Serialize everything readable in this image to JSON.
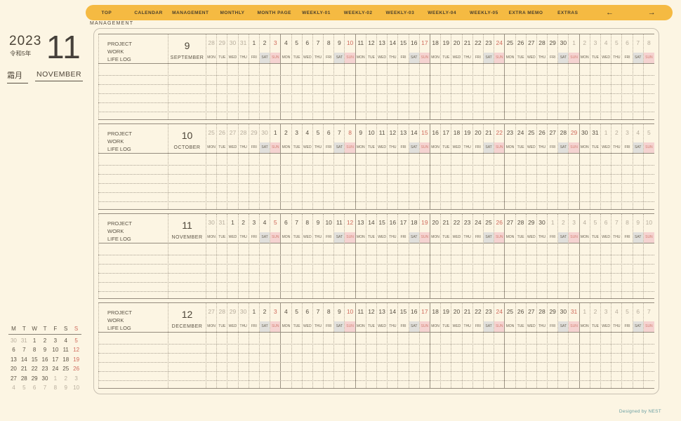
{
  "nav": {
    "items": [
      "TOP",
      "CALENDAR",
      "MANAGEMENT",
      "MONTHLY",
      "MONTH PAGE",
      "WEEKLY-01",
      "WEEKLY-02",
      "WEEKLY-03",
      "WEEKLY-04",
      "WEEKLY-05",
      "EXTRA MEMO",
      "EXTRAS"
    ],
    "arrow_left": "←",
    "arrow_right": "→"
  },
  "page_label": "MANAGEMENT",
  "sidebar": {
    "year": "2023",
    "era": "令和5年",
    "month_number": "11",
    "month_jp": "霜月",
    "month_en": "NOVEMBER"
  },
  "row_labels": [
    "PROJECT",
    "WORK",
    "LIFE LOG"
  ],
  "dow": [
    "MON",
    "TUE",
    "WED",
    "THU",
    "FRI",
    "SAT",
    "SUN"
  ],
  "months": [
    {
      "num": "9",
      "name": "SEPTEMBER",
      "days": [
        [
          "28",
          "o"
        ],
        [
          "29",
          "o"
        ],
        [
          "30",
          "o"
        ],
        [
          "31",
          "o"
        ],
        [
          "1",
          ""
        ],
        [
          "2",
          ""
        ],
        [
          "3",
          "s"
        ],
        [
          "4",
          ""
        ],
        [
          "5",
          ""
        ],
        [
          "6",
          ""
        ],
        [
          "7",
          ""
        ],
        [
          "8",
          ""
        ],
        [
          "9",
          ""
        ],
        [
          "10",
          "s"
        ],
        [
          "11",
          ""
        ],
        [
          "12",
          ""
        ],
        [
          "13",
          ""
        ],
        [
          "14",
          ""
        ],
        [
          "15",
          ""
        ],
        [
          "16",
          ""
        ],
        [
          "17",
          "s"
        ],
        [
          "18",
          ""
        ],
        [
          "19",
          ""
        ],
        [
          "20",
          ""
        ],
        [
          "21",
          ""
        ],
        [
          "22",
          ""
        ],
        [
          "23",
          ""
        ],
        [
          "24",
          "s"
        ],
        [
          "25",
          ""
        ],
        [
          "26",
          ""
        ],
        [
          "27",
          ""
        ],
        [
          "28",
          ""
        ],
        [
          "29",
          ""
        ],
        [
          "30",
          ""
        ],
        [
          "1",
          "o"
        ],
        [
          "2",
          "o"
        ],
        [
          "3",
          "o"
        ],
        [
          "4",
          "o"
        ],
        [
          "5",
          "o"
        ],
        [
          "6",
          "o"
        ],
        [
          "7",
          "o"
        ],
        [
          "8",
          "o"
        ]
      ]
    },
    {
      "num": "10",
      "name": "OCTOBER",
      "days": [
        [
          "25",
          "o"
        ],
        [
          "26",
          "o"
        ],
        [
          "27",
          "o"
        ],
        [
          "28",
          "o"
        ],
        [
          "29",
          "o"
        ],
        [
          "30",
          "o"
        ],
        [
          "1",
          ""
        ],
        [
          "2",
          ""
        ],
        [
          "3",
          ""
        ],
        [
          "4",
          ""
        ],
        [
          "5",
          ""
        ],
        [
          "6",
          ""
        ],
        [
          "7",
          ""
        ],
        [
          "8",
          "s"
        ],
        [
          "9",
          ""
        ],
        [
          "10",
          ""
        ],
        [
          "11",
          ""
        ],
        [
          "12",
          ""
        ],
        [
          "13",
          ""
        ],
        [
          "14",
          ""
        ],
        [
          "15",
          "s"
        ],
        [
          "16",
          ""
        ],
        [
          "17",
          ""
        ],
        [
          "18",
          ""
        ],
        [
          "19",
          ""
        ],
        [
          "20",
          ""
        ],
        [
          "21",
          ""
        ],
        [
          "22",
          "s"
        ],
        [
          "23",
          ""
        ],
        [
          "24",
          ""
        ],
        [
          "25",
          ""
        ],
        [
          "26",
          ""
        ],
        [
          "27",
          ""
        ],
        [
          "28",
          ""
        ],
        [
          "29",
          "s"
        ],
        [
          "30",
          ""
        ],
        [
          "31",
          ""
        ],
        [
          "1",
          "o"
        ],
        [
          "2",
          "o"
        ],
        [
          "3",
          "o"
        ],
        [
          "4",
          "o"
        ],
        [
          "5",
          "o"
        ]
      ]
    },
    {
      "num": "11",
      "name": "NOVEMBER",
      "days": [
        [
          "30",
          "o"
        ],
        [
          "31",
          "o"
        ],
        [
          "1",
          ""
        ],
        [
          "2",
          ""
        ],
        [
          "3",
          ""
        ],
        [
          "4",
          ""
        ],
        [
          "5",
          "s"
        ],
        [
          "6",
          ""
        ],
        [
          "7",
          ""
        ],
        [
          "8",
          ""
        ],
        [
          "9",
          ""
        ],
        [
          "10",
          ""
        ],
        [
          "11",
          ""
        ],
        [
          "12",
          "s"
        ],
        [
          "13",
          ""
        ],
        [
          "14",
          ""
        ],
        [
          "15",
          ""
        ],
        [
          "16",
          ""
        ],
        [
          "17",
          ""
        ],
        [
          "18",
          ""
        ],
        [
          "19",
          "s"
        ],
        [
          "20",
          ""
        ],
        [
          "21",
          ""
        ],
        [
          "22",
          ""
        ],
        [
          "23",
          ""
        ],
        [
          "24",
          ""
        ],
        [
          "25",
          ""
        ],
        [
          "26",
          "s"
        ],
        [
          "27",
          ""
        ],
        [
          "28",
          ""
        ],
        [
          "29",
          ""
        ],
        [
          "30",
          ""
        ],
        [
          "1",
          "o"
        ],
        [
          "2",
          "o"
        ],
        [
          "3",
          "o"
        ],
        [
          "4",
          "o"
        ],
        [
          "5",
          "o"
        ],
        [
          "6",
          "o"
        ],
        [
          "7",
          "o"
        ],
        [
          "8",
          "o"
        ],
        [
          "9",
          "o"
        ],
        [
          "10",
          "o"
        ]
      ]
    },
    {
      "num": "12",
      "name": "DECEMBER",
      "days": [
        [
          "27",
          "o"
        ],
        [
          "28",
          "o"
        ],
        [
          "29",
          "o"
        ],
        [
          "30",
          "o"
        ],
        [
          "1",
          ""
        ],
        [
          "2",
          ""
        ],
        [
          "3",
          "s"
        ],
        [
          "4",
          ""
        ],
        [
          "5",
          ""
        ],
        [
          "6",
          ""
        ],
        [
          "7",
          ""
        ],
        [
          "8",
          ""
        ],
        [
          "9",
          ""
        ],
        [
          "10",
          "s"
        ],
        [
          "11",
          ""
        ],
        [
          "12",
          ""
        ],
        [
          "13",
          ""
        ],
        [
          "14",
          ""
        ],
        [
          "15",
          ""
        ],
        [
          "16",
          ""
        ],
        [
          "17",
          "s"
        ],
        [
          "18",
          ""
        ],
        [
          "19",
          ""
        ],
        [
          "20",
          ""
        ],
        [
          "21",
          ""
        ],
        [
          "22",
          ""
        ],
        [
          "23",
          ""
        ],
        [
          "24",
          "s"
        ],
        [
          "25",
          ""
        ],
        [
          "26",
          ""
        ],
        [
          "27",
          ""
        ],
        [
          "28",
          ""
        ],
        [
          "29",
          ""
        ],
        [
          "30",
          ""
        ],
        [
          "31",
          "s"
        ],
        [
          "1",
          "o"
        ],
        [
          "2",
          "o"
        ],
        [
          "3",
          "o"
        ],
        [
          "4",
          "o"
        ],
        [
          "5",
          "o"
        ],
        [
          "6",
          "o"
        ],
        [
          "7",
          "o"
        ]
      ]
    }
  ],
  "mini_calendar": {
    "headers": [
      [
        "M",
        ""
      ],
      [
        "T",
        ""
      ],
      [
        "W",
        ""
      ],
      [
        "T",
        ""
      ],
      [
        "F",
        ""
      ],
      [
        "S",
        ""
      ],
      [
        "S",
        "s"
      ]
    ],
    "rows": [
      [
        [
          "30",
          "o"
        ],
        [
          "31",
          "o"
        ],
        [
          "1",
          ""
        ],
        [
          "2",
          ""
        ],
        [
          "3",
          ""
        ],
        [
          "4",
          ""
        ],
        [
          "5",
          "s"
        ]
      ],
      [
        [
          "6",
          ""
        ],
        [
          "7",
          ""
        ],
        [
          "8",
          ""
        ],
        [
          "9",
          ""
        ],
        [
          "10",
          ""
        ],
        [
          "11",
          ""
        ],
        [
          "12",
          "s"
        ]
      ],
      [
        [
          "13",
          ""
        ],
        [
          "14",
          ""
        ],
        [
          "15",
          ""
        ],
        [
          "16",
          ""
        ],
        [
          "17",
          ""
        ],
        [
          "18",
          ""
        ],
        [
          "19",
          "s"
        ]
      ],
      [
        [
          "20",
          ""
        ],
        [
          "21",
          ""
        ],
        [
          "22",
          ""
        ],
        [
          "23",
          ""
        ],
        [
          "24",
          ""
        ],
        [
          "25",
          ""
        ],
        [
          "26",
          "s"
        ]
      ],
      [
        [
          "27",
          ""
        ],
        [
          "28",
          ""
        ],
        [
          "29",
          ""
        ],
        [
          "30",
          ""
        ],
        [
          "1",
          "o"
        ],
        [
          "2",
          "o"
        ],
        [
          "3",
          "o"
        ]
      ],
      [
        [
          "4",
          "o"
        ],
        [
          "5",
          "o"
        ],
        [
          "6",
          "o"
        ],
        [
          "7",
          "o"
        ],
        [
          "8",
          "o"
        ],
        [
          "9",
          "o"
        ],
        [
          "10",
          "o"
        ]
      ]
    ]
  },
  "footer": "Designed by NEST",
  "colors": {
    "nav_bg": "#f5ba42",
    "sunday_red": "#cf6a5c",
    "sun_bg": "#f5d3d1",
    "sat_bg": "#e1e0dc",
    "out_gray": "#b7ad9c",
    "ink": "#564e41",
    "page_bg": "#fcf5e3"
  }
}
